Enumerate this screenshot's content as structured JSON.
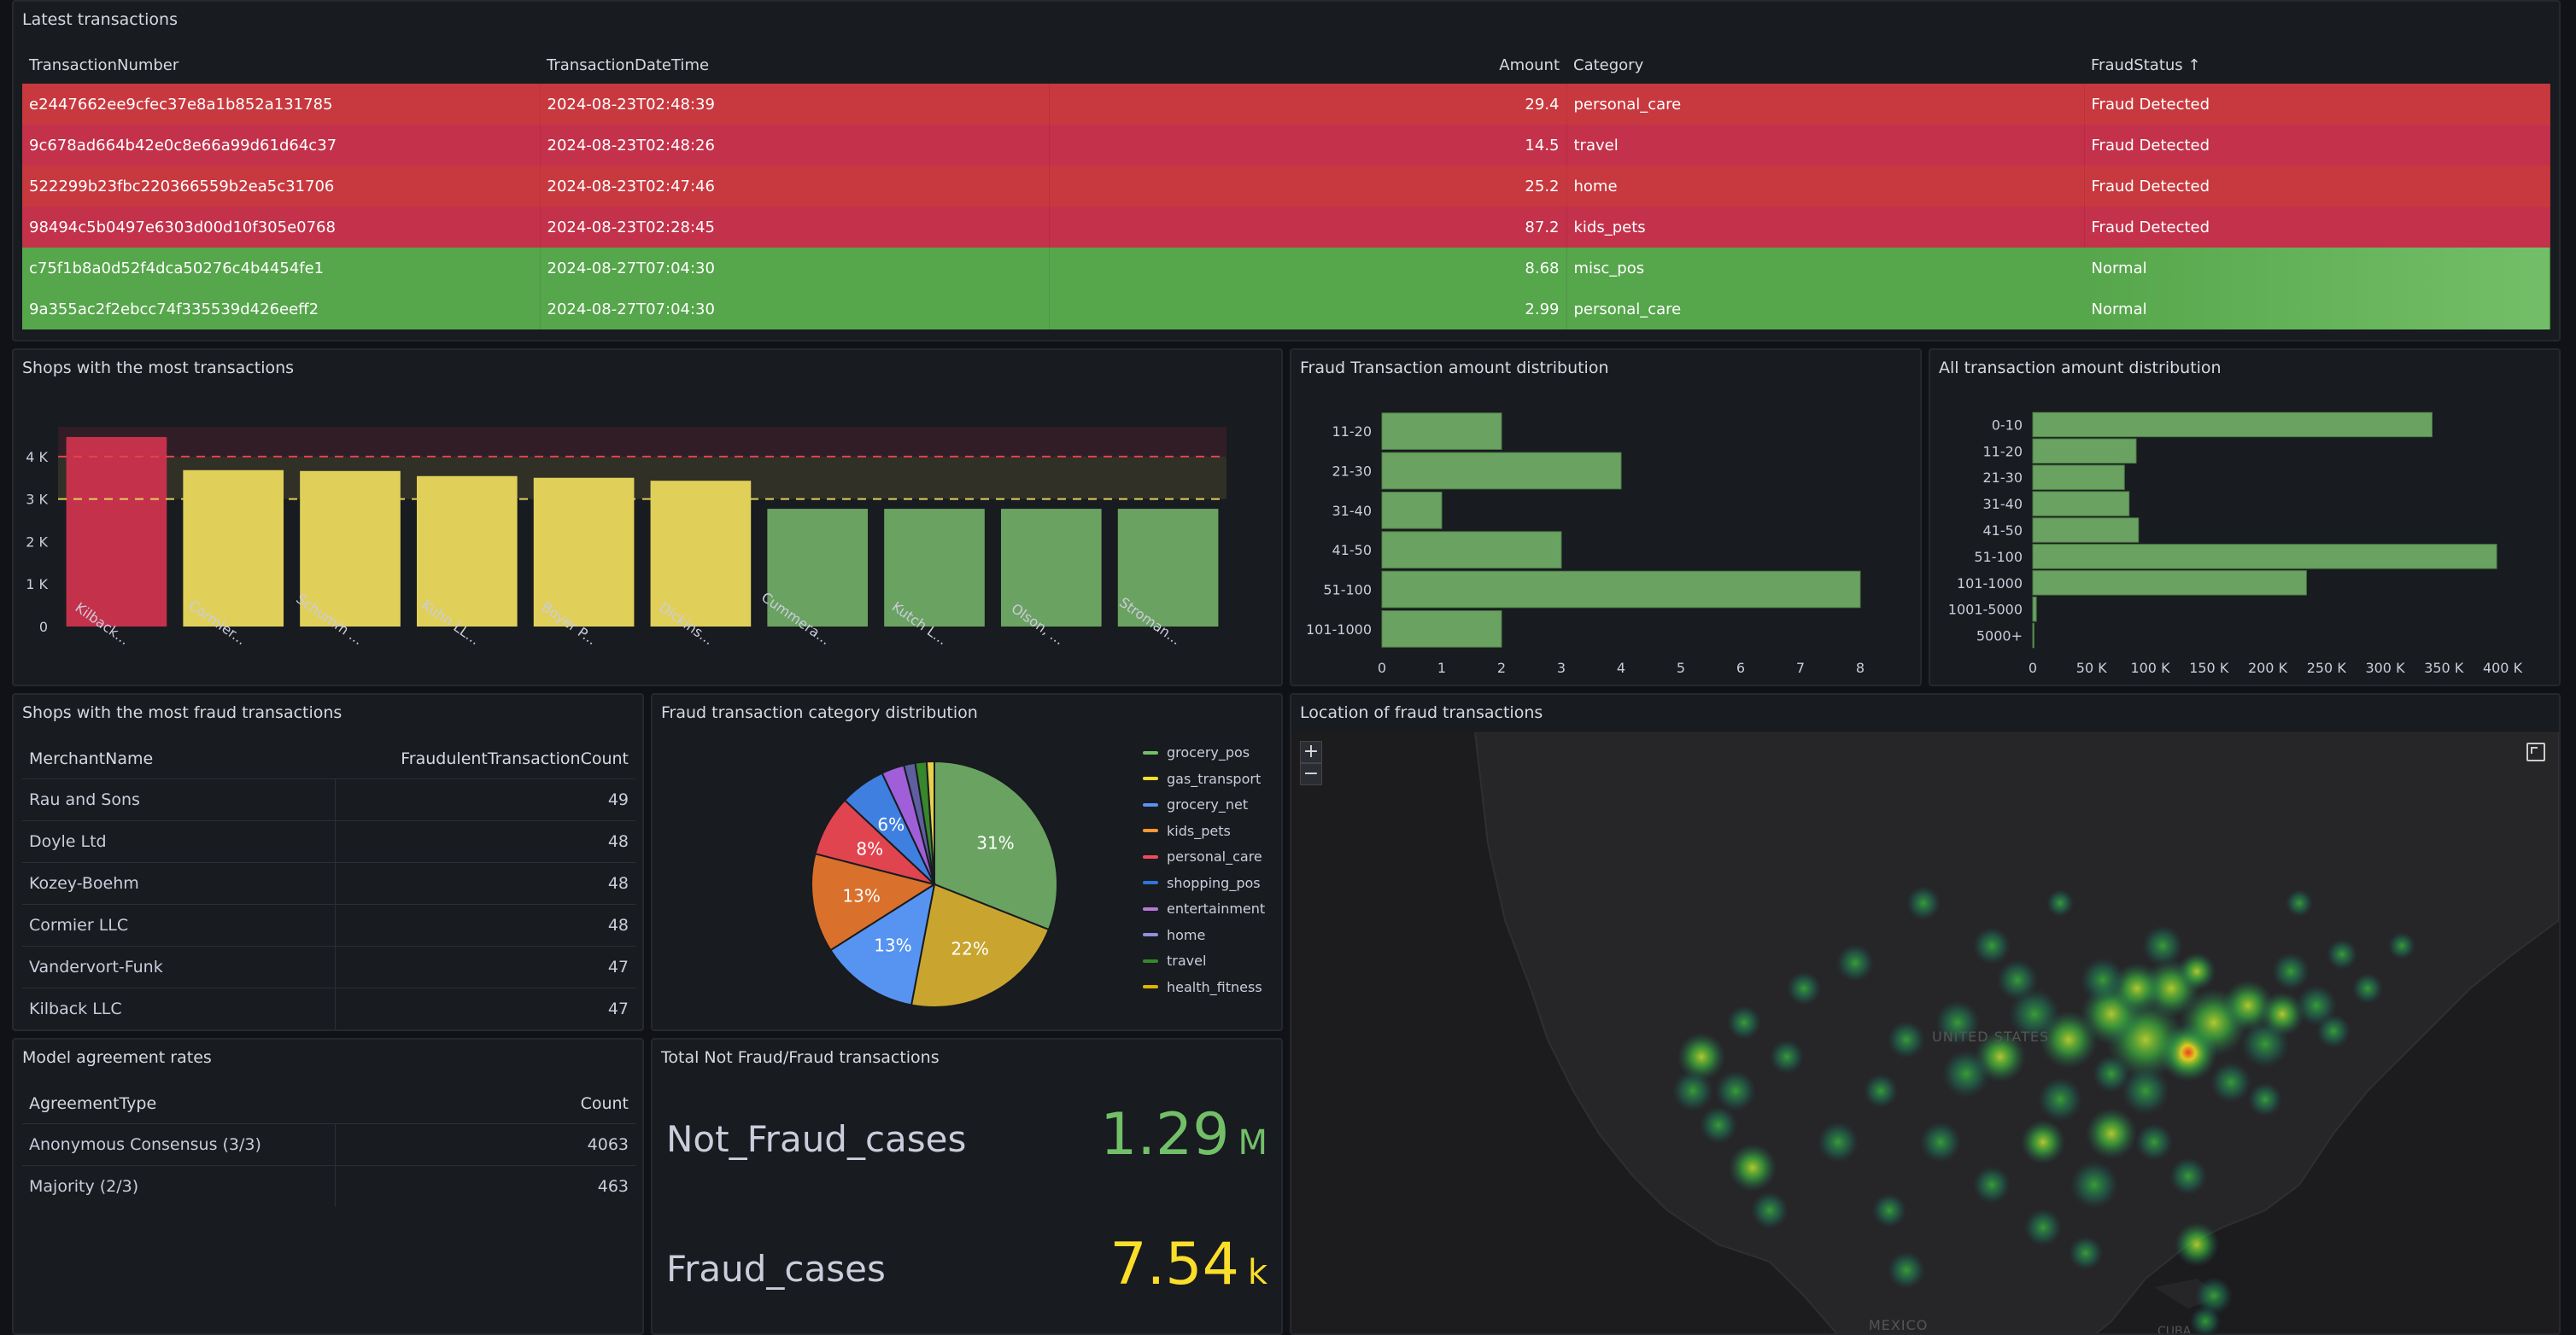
{
  "colors": {
    "fraud_row": "#c4314b",
    "normal_row": "#56a64b",
    "bar_red": "#c4314b",
    "bar_yellow": "#e0d05a",
    "bar_green": "#6aa262",
    "hbar_green": "#6aa262",
    "stat_green": "#73bf69",
    "stat_yellow": "#fade2a"
  },
  "latest_transactions": {
    "title": "Latest transactions",
    "columns": [
      "TransactionNumber",
      "TransactionDateTime",
      "Amount",
      "Category",
      "FraudStatus"
    ],
    "sort_indicator": "↑",
    "rows": [
      {
        "id": "e2447662ee9cfec37e8a1b852a131785",
        "dt": "2024-08-23T02:48:39",
        "amount": "29.4",
        "category": "personal_care",
        "status": "Fraud Detected",
        "kind": "fraud"
      },
      {
        "id": "9c678ad664b42e0c8e66a99d61d64c37",
        "dt": "2024-08-23T02:48:26",
        "amount": "14.5",
        "category": "travel",
        "status": "Fraud Detected",
        "kind": "fraud"
      },
      {
        "id": "522299b23fbc220366559b2ea5c31706",
        "dt": "2024-08-23T02:47:46",
        "amount": "25.2",
        "category": "home",
        "status": "Fraud Detected",
        "kind": "fraud"
      },
      {
        "id": "98494c5b0497e6303d00d10f305e0768",
        "dt": "2024-08-23T02:28:45",
        "amount": "87.2",
        "category": "kids_pets",
        "status": "Fraud Detected",
        "kind": "fraud"
      },
      {
        "id": "c75f1b8a0d52f4dca50276c4b4454fe1",
        "dt": "2024-08-27T07:04:30",
        "amount": "8.68",
        "category": "misc_pos",
        "status": "Normal",
        "kind": "normal"
      },
      {
        "id": "9a355ac2f2ebcc74f335539d426eeff2",
        "dt": "2024-08-27T07:04:30",
        "amount": "2.99",
        "category": "personal_care",
        "status": "Normal",
        "kind": "normal"
      }
    ]
  },
  "shops_most_tx": {
    "title": "Shops with the most transactions",
    "chart_data": {
      "type": "bar",
      "categories": [
        "Kilback...",
        "Cormier...",
        "Schumm ...",
        "Kuhn LL...",
        "Boyer P...",
        "Dickins...",
        "Cummera...",
        "Kutch L...",
        "Olson, ...",
        "Stroman..."
      ],
      "values": [
        4460,
        3680,
        3660,
        3540,
        3500,
        3430,
        2770,
        2770,
        2770,
        2770
      ],
      "y_ticks": [
        "0",
        "1 K",
        "2 K",
        "3 K",
        "4 K"
      ],
      "ylim": [
        0,
        4700
      ],
      "thresholds": [
        3000,
        4000
      ],
      "bar_colors": [
        "red",
        "yellow",
        "yellow",
        "yellow",
        "yellow",
        "yellow",
        "green",
        "green",
        "green",
        "green"
      ]
    }
  },
  "fraud_amount_dist": {
    "title": "Fraud Transaction amount distribution",
    "chart_data": {
      "type": "bar",
      "orientation": "horizontal",
      "categories": [
        "11-20",
        "21-30",
        "31-40",
        "41-50",
        "51-100",
        "101-1000"
      ],
      "values": [
        2,
        4,
        1,
        3,
        8,
        2
      ],
      "x_ticks": [
        "0",
        "1",
        "2",
        "3",
        "4",
        "5",
        "6",
        "7",
        "8"
      ],
      "xlim": [
        0,
        8
      ]
    }
  },
  "all_amount_dist": {
    "title": "All transaction amount distribution",
    "chart_data": {
      "type": "bar",
      "orientation": "horizontal",
      "categories": [
        "0-10",
        "11-20",
        "21-30",
        "31-40",
        "41-50",
        "51-100",
        "101-1000",
        "1001-5000",
        "5000+"
      ],
      "values": [
        340000,
        88000,
        78000,
        82000,
        90000,
        395000,
        233000,
        3000,
        1000
      ],
      "x_ticks": [
        "0",
        "50 K",
        "100 K",
        "150 K",
        "200 K",
        "250 K",
        "300 K",
        "350 K",
        "400 K"
      ],
      "xlim": [
        0,
        400000
      ]
    }
  },
  "shops_most_fraud": {
    "title": "Shops with the most fraud transactions",
    "columns": [
      "MerchantName",
      "FraudulentTransactionCount"
    ],
    "rows": [
      {
        "name": "Rau and Sons",
        "count": "49"
      },
      {
        "name": "Doyle Ltd",
        "count": "48"
      },
      {
        "name": "Kozey-Boehm",
        "count": "48"
      },
      {
        "name": "Cormier LLC",
        "count": "48"
      },
      {
        "name": "Vandervort-Funk",
        "count": "47"
      },
      {
        "name": "Kilback LLC",
        "count": "47"
      }
    ]
  },
  "fraud_category_dist": {
    "title": "Fraud transaction category distribution",
    "chart_data": {
      "type": "pie",
      "categories": [
        "grocery_pos",
        "gas_transport",
        "grocery_net",
        "kids_pets",
        "personal_care",
        "shopping_pos",
        "entertainment",
        "home",
        "travel",
        "health_fitness"
      ],
      "values": [
        31,
        22,
        13,
        13,
        8,
        6,
        3,
        1.5,
        1.5,
        1
      ],
      "slice_labels": [
        "31%",
        "22%",
        "13%",
        "13%",
        "8%",
        "6%",
        "",
        "",
        "",
        ""
      ],
      "colors": [
        "#6aa262",
        "#c9a530",
        "#5794f2",
        "#d9702b",
        "#e0444f",
        "#3f7fe0",
        "#a05ed9",
        "#5d5fa0",
        "#37872d",
        "#e8d14a"
      ]
    }
  },
  "legend": {
    "items": [
      {
        "label": "grocery_pos",
        "color": "#73bf69"
      },
      {
        "label": "gas_transport",
        "color": "#fade2a"
      },
      {
        "label": "grocery_net",
        "color": "#5794f2"
      },
      {
        "label": "kids_pets",
        "color": "#ff9830"
      },
      {
        "label": "personal_care",
        "color": "#f2495c"
      },
      {
        "label": "shopping_pos",
        "color": "#3274d9"
      },
      {
        "label": "entertainment",
        "color": "#b877d9"
      },
      {
        "label": "home",
        "color": "#8f8fdf"
      },
      {
        "label": "travel",
        "color": "#37872d"
      },
      {
        "label": "health_fitness",
        "color": "#e0b400"
      }
    ]
  },
  "model_agreement": {
    "title": "Model agreement rates",
    "columns": [
      "AgreementType",
      "Count"
    ],
    "rows": [
      {
        "type": "Anonymous Consensus (3/3)",
        "count": "4063"
      },
      {
        "type": "Majority (2/3)",
        "count": "463"
      }
    ]
  },
  "totals": {
    "title": "Total Not Fraud/Fraud transactions",
    "not_fraud_label": "Not_Fraud_cases",
    "not_fraud_value": "1.29",
    "not_fraud_unit": "M",
    "fraud_label": "Fraud_cases",
    "fraud_value": "7.54",
    "fraud_unit": "k"
  },
  "map": {
    "title": "Location of fraud transactions",
    "zoom_in": "+",
    "zoom_out": "−",
    "labels": {
      "us": "UNITED STATES",
      "mexico": "MEXICO",
      "cuba": "CUBA"
    }
  }
}
